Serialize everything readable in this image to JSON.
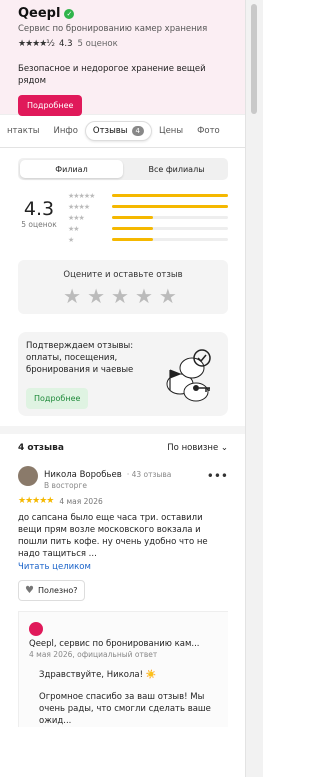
{
  "company": {
    "name": "Qeepl",
    "verified_mark": "✓",
    "subtitle": "Сервис по бронированию камер хранения",
    "stars": "★★★★½",
    "rating": "4.3",
    "reviews_count": "5 оценок",
    "description": "Безопасное и недорогое хранение вещей рядом",
    "more_button": "Подробнее"
  },
  "tabs": [
    {
      "label": "нтакты"
    },
    {
      "label": "Инфо"
    },
    {
      "label": "Отзывы",
      "badge": "4",
      "active": true
    },
    {
      "label": "Цены"
    },
    {
      "label": "Фото"
    }
  ],
  "branch_toggle": {
    "left": "Филиал",
    "right": "Все филиалы"
  },
  "summary": {
    "rating": "4.3",
    "count": "5 оценок",
    "distribution": [
      {
        "stars": "★★★★★",
        "fraction": 1.0
      },
      {
        "stars": "★★★★",
        "fraction": 1.0
      },
      {
        "stars": "★★★",
        "fraction": 0.35
      },
      {
        "stars": "★★",
        "fraction": 0.35
      },
      {
        "stars": "★",
        "fraction": 0.35
      }
    ]
  },
  "rate_box": {
    "label": "Оцените и оставьте отзыв",
    "stars": "★★★★★"
  },
  "promo": {
    "text": "Подтверждаем отзывы: оплаты, посещения, бронирования и чаевые",
    "button": "Подробнее"
  },
  "reviews_header": {
    "title": "4 отзыва",
    "sort": "По новизне ⌄"
  },
  "review": {
    "author": "Никола Воробьев",
    "author_meta": "· 43 отзыва",
    "author_tag": "В восторге",
    "menu": "•••",
    "stars": "★★★★★",
    "date": "4 мая 2026",
    "text": "до сапсана было еще часа три. оставили вещи прям возле московского вокзала и пошли пить кофе. ну очень удобно что не надо тащиться ...",
    "read_more": "Читать целиком",
    "useful": "Полезно?"
  },
  "reply": {
    "name": "Qeepl, сервис по бронированию кам...",
    "meta": "4 мая 2026, официальный ответ",
    "text1": "Здравствуйте, Никола! ☀️",
    "text2": "Огромное спасибо за ваш отзыв! Мы очень рады, что смогли сделать ваше ожид..."
  }
}
